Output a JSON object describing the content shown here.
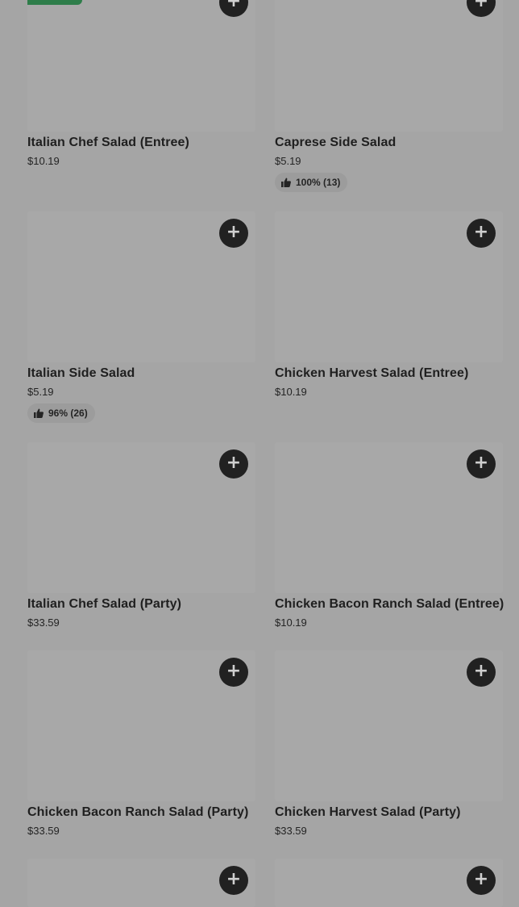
{
  "menu": {
    "add_label": "+",
    "items": [
      {
        "name": "Italian Chef Salad (Entree)",
        "price": "$10.19"
      },
      {
        "name": "Caprese Side Salad",
        "price": "$5.19",
        "rating": "100% (13)"
      },
      {
        "name": "Italian Side Salad",
        "price": "$5.19",
        "rating": "96% (26)"
      },
      {
        "name": "Chicken Harvest Salad (Entree)",
        "price": "$10.19"
      },
      {
        "name": "Italian Chef Salad (Party)",
        "price": "$33.59"
      },
      {
        "name": "Chicken Bacon Ranch Salad (Entree)",
        "price": "$10.19"
      },
      {
        "name": "Chicken Bacon Ranch Salad (Party)",
        "price": "$33.59"
      },
      {
        "name": "Chicken Harvest Salad (Party)",
        "price": "$33.59"
      }
    ]
  },
  "colors": {
    "badge": "#2e7d4a",
    "add_button": "#212121",
    "overlay": "#a5a5a5"
  }
}
